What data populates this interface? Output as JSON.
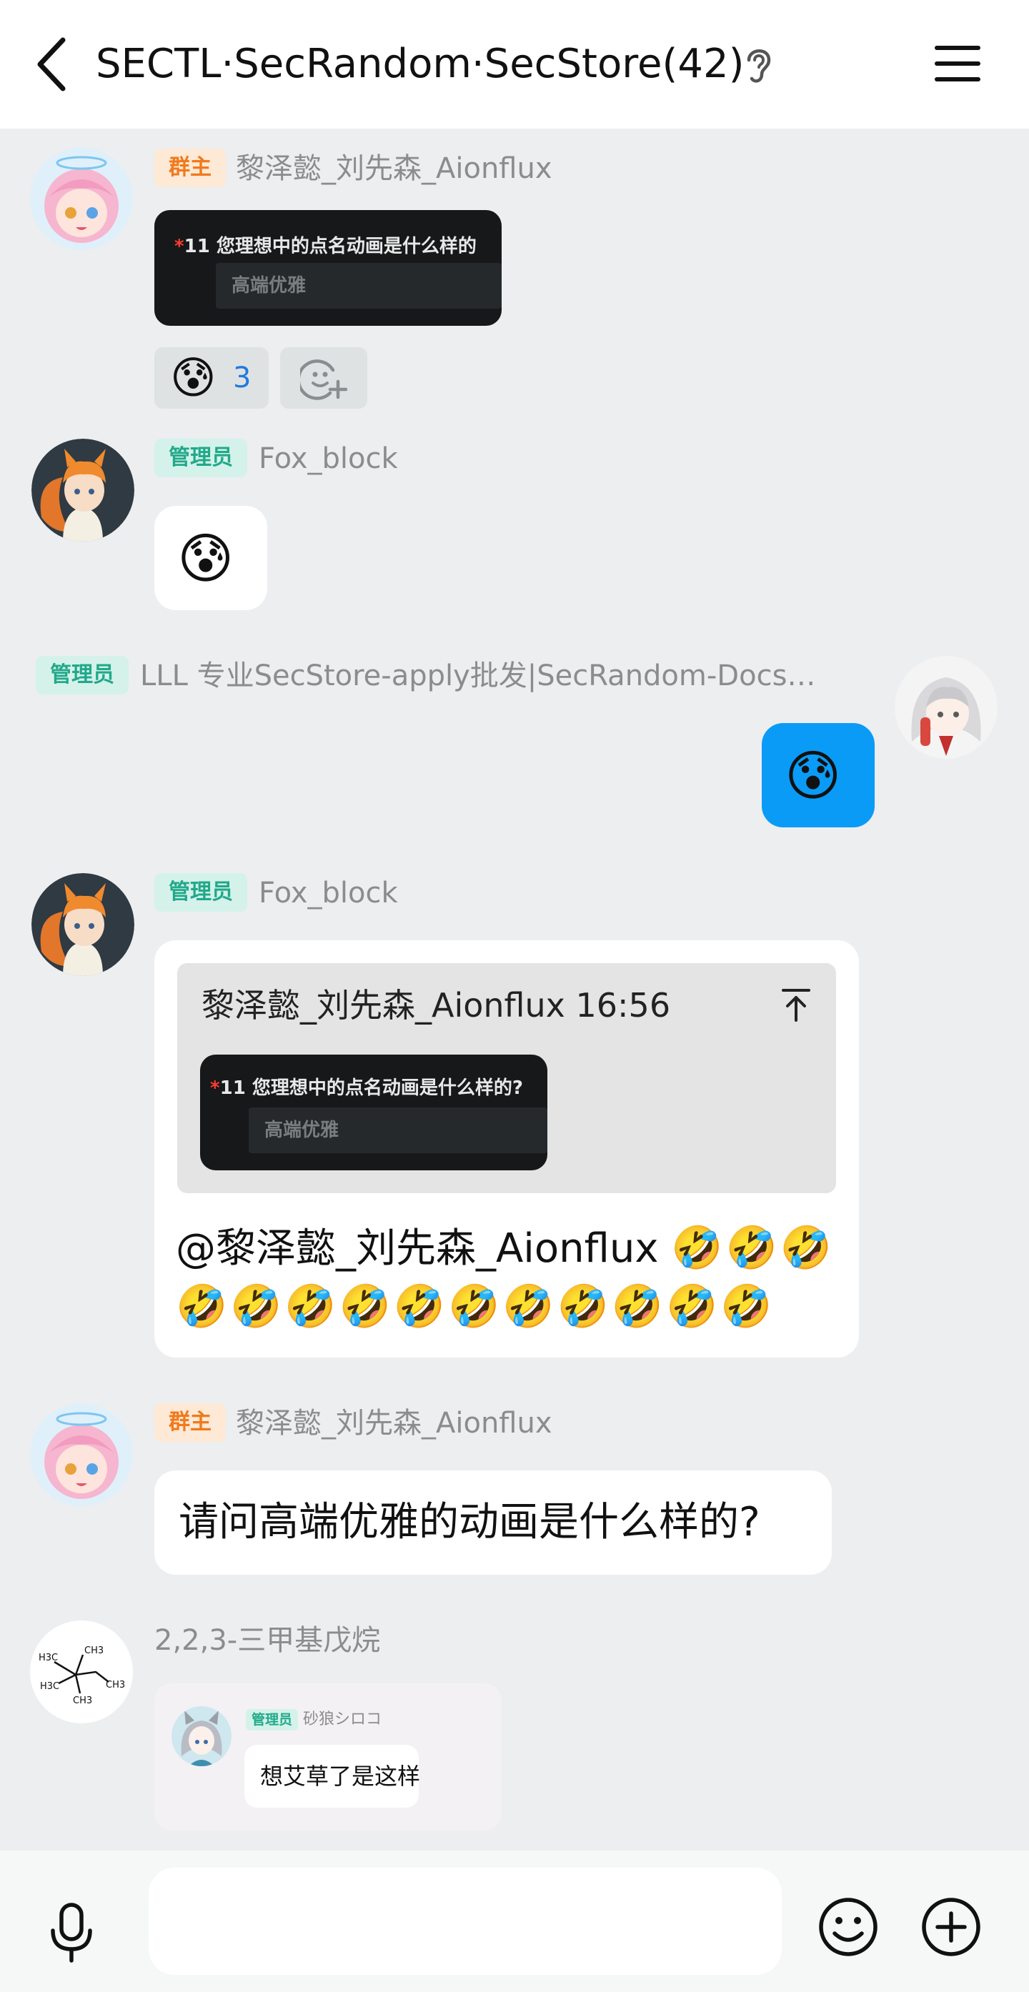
{
  "header": {
    "title": "SECTL·SecRandom·SecStore(42)"
  },
  "messages": [
    {
      "tag": "群主",
      "name": "黎泽懿_刘先森_Aionflux",
      "quoted_question_prefix": "*",
      "quoted_question": "11 您理想中的点名动画是什么样的",
      "quoted_answer": "高端优雅",
      "reaction_count": "3"
    },
    {
      "tag": "管理员",
      "name": "Fox_block"
    },
    {
      "tag": "管理员",
      "name": "LLL 专业SecStore-apply批发|SecRandom-Docs…"
    },
    {
      "tag": "管理员",
      "name": "Fox_block",
      "reply_header": "黎泽懿_刘先森_Aionflux 16:56",
      "reply_question_prefix": "*",
      "reply_question": "11 您理想中的点名动画是什么样的?",
      "reply_answer": "高端优雅",
      "text": "@黎泽懿_刘先森_Aionflux"
    },
    {
      "tag": "群主",
      "name": "黎泽懿_刘先森_Aionflux",
      "text": "请问高端优雅的动画是什么样的?"
    },
    {
      "name": "2,2,3-三甲基戊烷",
      "avatar_labels": [
        "CH3",
        "H3C",
        "H3C",
        "CH3",
        "CH3"
      ],
      "sticker_tag": "管理员",
      "sticker_name": "砂狼シロコ",
      "sticker_text": "想艾草了是这样"
    }
  ],
  "colors": {
    "owner_tag": "#f07a1c",
    "admin_tag": "#21a98a",
    "self_bubble": "#0a9bf7",
    "accent_blue": "#1f7ae0"
  },
  "icons": [
    "back-icon",
    "ear-icon",
    "menu-icon",
    "add-reaction-icon",
    "mic-icon",
    "emoji-icon",
    "plus-icon"
  ]
}
